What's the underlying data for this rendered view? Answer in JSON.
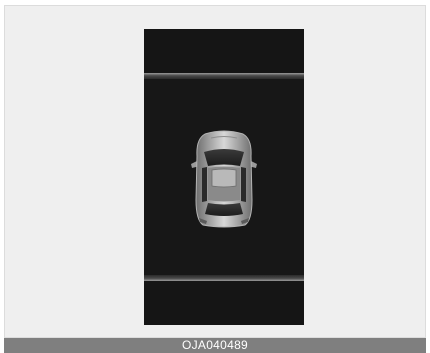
{
  "figure": {
    "caption": "OJA040489",
    "subject_icon": "car-top-view-icon"
  },
  "colors": {
    "screen_background": "#171717",
    "frame_background": "#efefef",
    "caption_background": "#7f7f7f",
    "caption_text": "#ffffff"
  }
}
